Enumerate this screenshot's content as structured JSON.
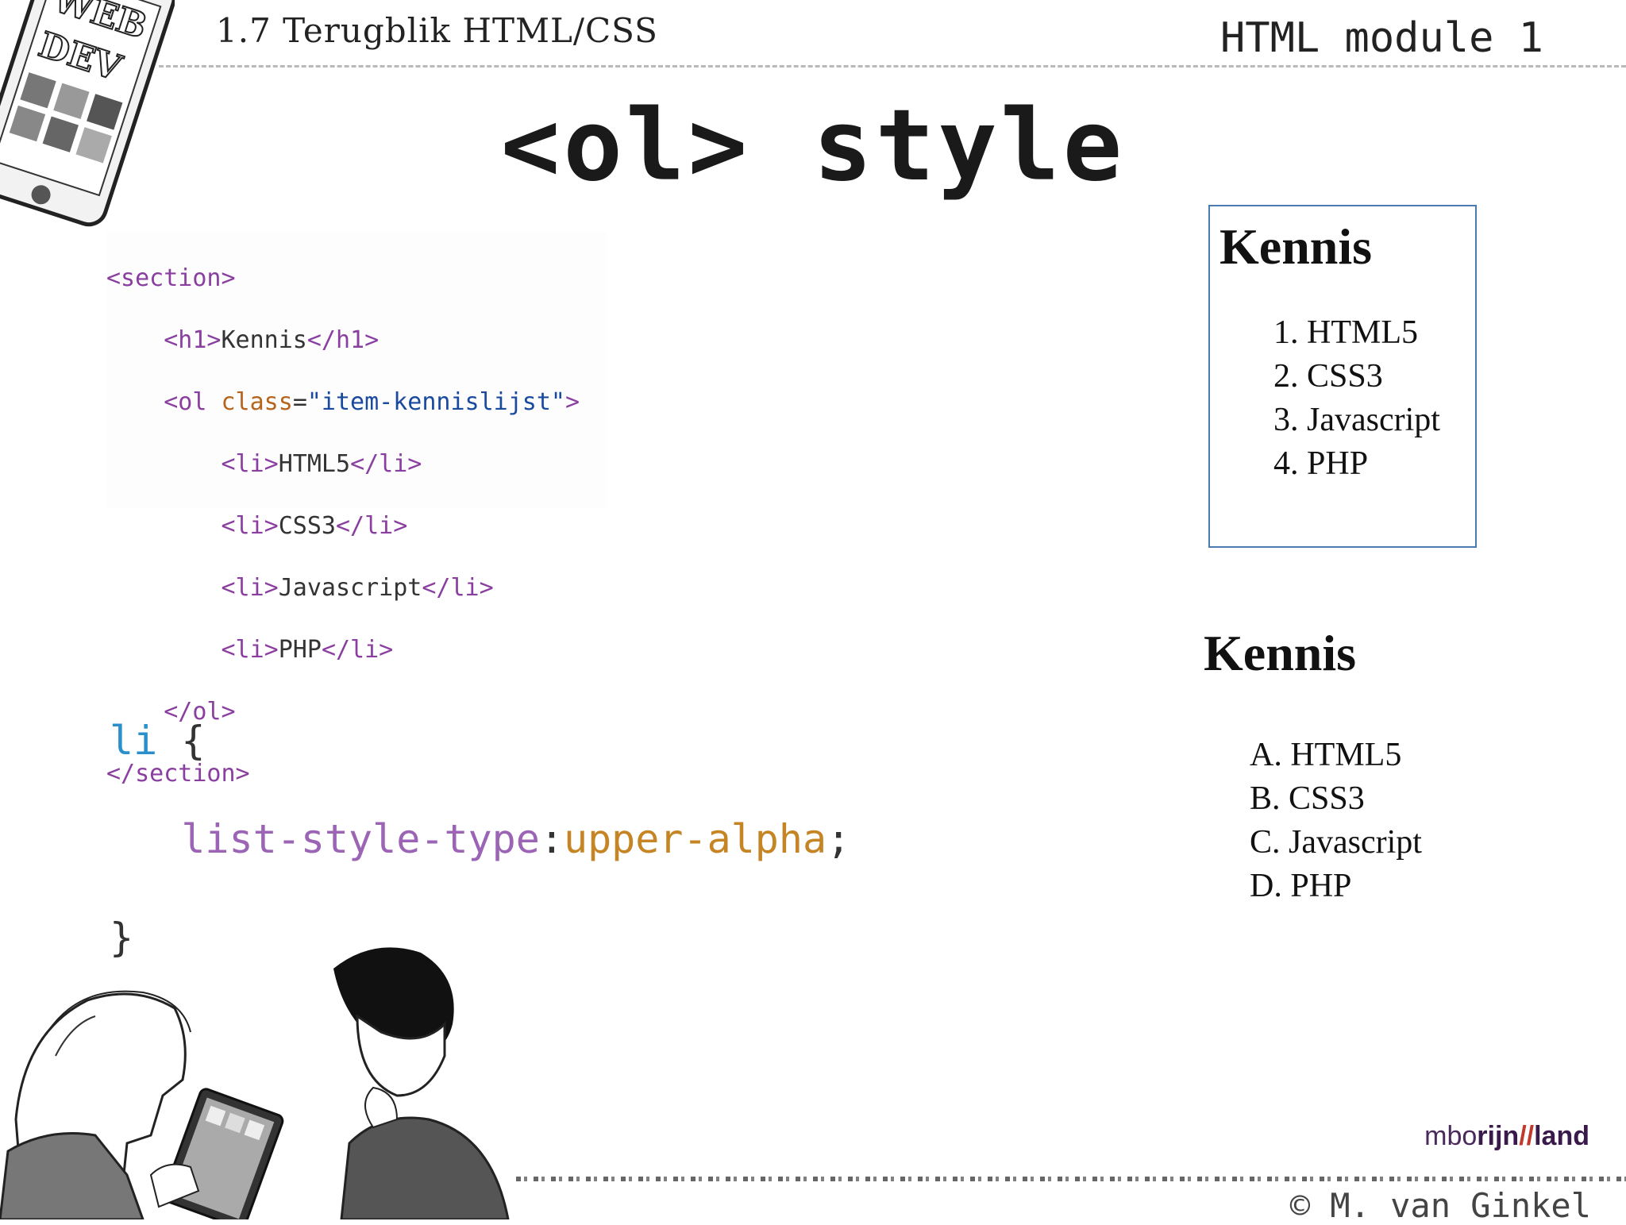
{
  "header": {
    "lesson_title": "1.7 Terugblik HTML/CSS",
    "module_title": "HTML module 1"
  },
  "slide": {
    "title": "<ol> style"
  },
  "html_code": {
    "lines": [
      {
        "t1": "<section>",
        "t2": "",
        "t3": "",
        "t4": "",
        "t5": "",
        "t6": ""
      },
      {
        "indent": "    ",
        "t1": "<h1>",
        "t2": "Kennis",
        "t3": "</h1>"
      },
      {
        "indent": "    ",
        "t1": "<ol ",
        "attr": "class",
        "eq": "=",
        "str": "\"item-kennislijst\"",
        "close": ">"
      },
      {
        "indent": "        ",
        "t1": "<li>",
        "t2": "HTML5",
        "t3": "</li>"
      },
      {
        "indent": "        ",
        "t1": "<li>",
        "t2": "CSS3",
        "t3": "</li>"
      },
      {
        "indent": "        ",
        "t1": "<li>",
        "t2": "Javascript",
        "t3": "</li>"
      },
      {
        "indent": "        ",
        "t1": "<li>",
        "t2": "PHP",
        "t3": "</li>"
      },
      {
        "indent": "    ",
        "t1": "</ol>"
      },
      {
        "t1": "</section>"
      }
    ]
  },
  "css_code": {
    "selector": "li",
    "open_brace": "{",
    "property": "list-style-type",
    "colon": ":",
    "value": "upper-alpha",
    "semicolon": ";",
    "close_brace": "}"
  },
  "preview_decimal": {
    "heading": "Kennis",
    "items": [
      "1. HTML5",
      "2. CSS3",
      "3. Javascript",
      "4. PHP"
    ]
  },
  "preview_alpha": {
    "heading": "Kennis",
    "items": [
      "A. HTML5",
      "B. CSS3",
      "C. Javascript",
      "D. PHP"
    ]
  },
  "logo": {
    "part1": "mbo",
    "part2": "rijn",
    "part3": "//",
    "part4": "land"
  },
  "footer": {
    "copyright": "© M. van Ginkel"
  },
  "phone_sticker": {
    "line1": "WEB",
    "line2": "DEV"
  }
}
